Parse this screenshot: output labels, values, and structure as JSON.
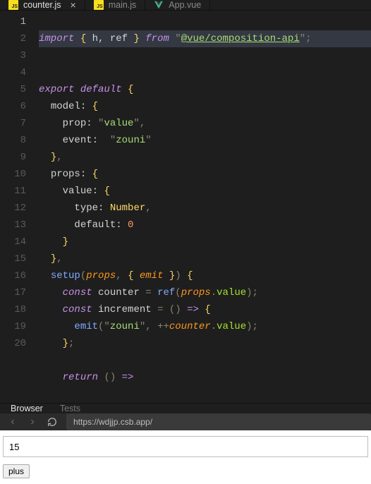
{
  "tabs": [
    {
      "label": "counter.js",
      "type": "js",
      "active": true,
      "closeable": true
    },
    {
      "label": "main.js",
      "type": "js",
      "active": false,
      "closeable": false
    },
    {
      "label": "App.vue",
      "type": "vue",
      "active": false,
      "closeable": false
    }
  ],
  "editor": {
    "line_count": 20,
    "current_line": 1,
    "code": {
      "l1": {
        "keyword": "import",
        "brace_open": "{",
        "idents": "h, ref",
        "brace_close": "}",
        "from": "from",
        "quote": "\"",
        "module": "@vue/composition-api",
        "semi": ";"
      },
      "l3": {
        "export": "export",
        "default": "default",
        "brace": "{"
      },
      "l4": {
        "key": "model:",
        "brace": "{"
      },
      "l5": {
        "key": "prop:",
        "q": "\"",
        "str": "value",
        "comma": ","
      },
      "l6": {
        "key": "event:",
        "q": "\"",
        "str": "zouni"
      },
      "l7": {
        "brace": "}",
        "comma": ","
      },
      "l8": {
        "key": "props:",
        "brace": "{"
      },
      "l9": {
        "key": "value:",
        "brace": "{"
      },
      "l10": {
        "key": "type:",
        "type": "Number",
        "comma": ","
      },
      "l11": {
        "key": "default:",
        "num": "0"
      },
      "l12": {
        "brace": "}"
      },
      "l13": {
        "brace": "}",
        "comma": ","
      },
      "l14": {
        "func": "setup",
        "paren_open": "(",
        "param1": "props",
        "comma": ",",
        "brace_open": "{",
        "param2": "emit",
        "brace_close": "}",
        "paren_close": ")",
        "brace": "{"
      },
      "l15": {
        "const": "const",
        "name": "counter",
        "eq": "=",
        "fn": "ref",
        "paren_open": "(",
        "obj": "props",
        "dot": ".",
        "prop": "value",
        "paren_close": ")",
        "semi": ";"
      },
      "l16": {
        "const": "const",
        "name": "increment",
        "eq": "=",
        "paren": "()",
        "arrow": "=>",
        "brace": "{"
      },
      "l17": {
        "fn": "emit",
        "paren_open": "(",
        "q": "\"",
        "str": "zouni",
        "comma": ",",
        "op": "++",
        "obj": "counter",
        "dot": ".",
        "prop": "value",
        "paren_close": ")",
        "semi": ";"
      },
      "l18": {
        "brace": "}",
        "semi": ";"
      },
      "l20": {
        "return": "return",
        "paren": "()",
        "arrow": "=>"
      }
    }
  },
  "panel": {
    "tabs": [
      "Browser",
      "Tests"
    ],
    "active": "Browser"
  },
  "urlbar": {
    "url": "https://wdjjp.csb.app/"
  },
  "preview": {
    "value": "15",
    "button": "plus"
  }
}
